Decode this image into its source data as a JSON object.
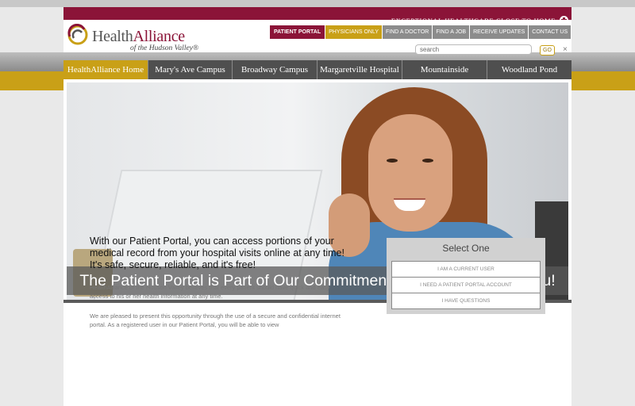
{
  "header": {
    "tagline": "EXCEPTIONAL HEALTHCARE CLOSE TO HOME",
    "logo": {
      "name_part1": "Health",
      "name_part2": "Alliance",
      "subtitle": "of the Hudson Valley®"
    },
    "top_links": [
      "PATIENT PORTAL",
      "PHYSICIANS ONLY",
      "FIND A DOCTOR",
      "FIND A JOB",
      "RECEIVE UPDATES",
      "CONTACT US"
    ],
    "search_placeholder": "search",
    "search_button": "GO",
    "close_symbol": "×"
  },
  "nav": [
    "HealthAlliance Home",
    "Mary's Ave Campus",
    "Broadway Campus",
    "Margaretville Hospital",
    "Mountainside",
    "Woodland Pond"
  ],
  "hero": {
    "title": "The Patient Portal is Part of Our Commitment to Quality Care for You!"
  },
  "content": {
    "intro": "With our Patient Portal, you can access portions of your medical record from your hospital visits online at any time! It's safe, secure, reliable, and it's free!",
    "para1": "HealthAlliance of the Hudson Valley believes that every patient should have quick and easy access to his or her health information at any time.",
    "para2": "We are pleased to present this opportunity through the use of a secure and confidential internet portal. As a registered user in our Patient Portal, you will be able to view"
  },
  "select_box": {
    "title": "Select One",
    "options": [
      "I AM A CURRENT USER",
      "I NEED A PATIENT PORTAL ACCOUNT",
      "I HAVE QUESTIONS"
    ]
  },
  "colors": {
    "brand_red": "#8b1438",
    "brand_gold": "#c9a017",
    "nav_gray": "#4f4f4f"
  }
}
